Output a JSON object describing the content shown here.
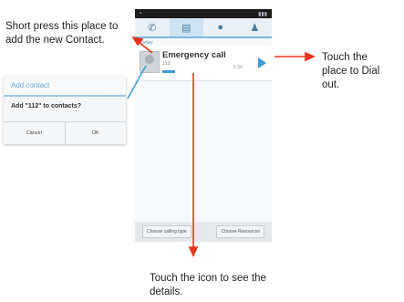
{
  "annotations": {
    "add_contact": "Short press this place to add the new Contact.",
    "dial": "Touch the place to Dial out.",
    "details": "Touch the icon to see the details."
  },
  "phone": {
    "section_label": "Today",
    "call": {
      "name": "Emergency call",
      "number": "112",
      "time": "5:30"
    },
    "bottom_buttons": [
      "Choose calling type",
      "Choose Resources"
    ]
  },
  "dialog": {
    "title": "Add contact",
    "message": "Add \"112\" to contacts?",
    "cancel_label": "Cancel",
    "ok_label": "OK"
  },
  "colors": {
    "arrow": "#e8341c",
    "accent": "#3c9ad8"
  }
}
